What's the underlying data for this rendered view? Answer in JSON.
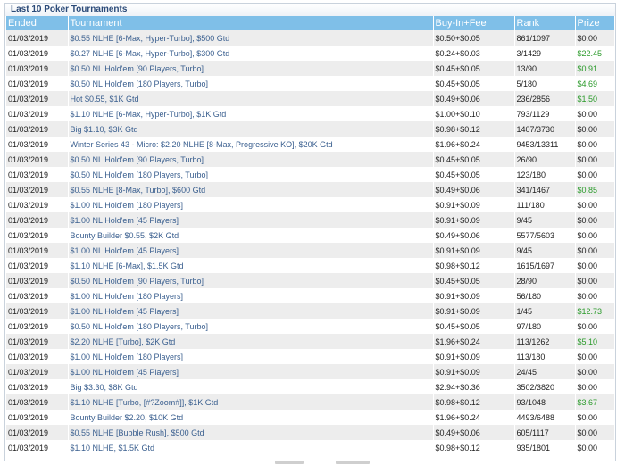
{
  "panel": {
    "title": "Last 10 Poker Tournaments"
  },
  "columns": [
    "Ended",
    "Tournament",
    "Buy-In+Fee",
    "Rank",
    "Prize"
  ],
  "rows": [
    {
      "ended": "01/03/2019",
      "tournament": "$0.55 NLHE [6-Max, Hyper-Turbo], $500 Gtd",
      "buyin": "$0.50+$0.05",
      "rank": "861/1097",
      "prize": "$0.00",
      "win": false
    },
    {
      "ended": "01/03/2019",
      "tournament": "$0.27 NLHE [6-Max, Hyper-Turbo], $300 Gtd",
      "buyin": "$0.24+$0.03",
      "rank": "3/1429",
      "prize": "$22.45",
      "win": true
    },
    {
      "ended": "01/03/2019",
      "tournament": "$0.50 NL Hold'em [90 Players, Turbo]",
      "buyin": "$0.45+$0.05",
      "rank": "13/90",
      "prize": "$0.91",
      "win": true
    },
    {
      "ended": "01/03/2019",
      "tournament": "$0.50 NL Hold'em [180 Players, Turbo]",
      "buyin": "$0.45+$0.05",
      "rank": "5/180",
      "prize": "$4.69",
      "win": true
    },
    {
      "ended": "01/03/2019",
      "tournament": "Hot $0.55, $1K Gtd",
      "buyin": "$0.49+$0.06",
      "rank": "236/2856",
      "prize": "$1.50",
      "win": true
    },
    {
      "ended": "01/03/2019",
      "tournament": "$1.10 NLHE [6-Max, Hyper-Turbo], $1K Gtd",
      "buyin": "$1.00+$0.10",
      "rank": "793/1129",
      "prize": "$0.00",
      "win": false
    },
    {
      "ended": "01/03/2019",
      "tournament": "Big $1.10, $3K Gtd",
      "buyin": "$0.98+$0.12",
      "rank": "1407/3730",
      "prize": "$0.00",
      "win": false
    },
    {
      "ended": "01/03/2019",
      "tournament": "Winter Series 43 - Micro: $2.20 NLHE [8-Max, Progressive KO], $20K Gtd",
      "buyin": "$1.96+$0.24",
      "rank": "9453/13311",
      "prize": "$0.00",
      "win": false
    },
    {
      "ended": "01/03/2019",
      "tournament": "$0.50 NL Hold'em [90 Players, Turbo]",
      "buyin": "$0.45+$0.05",
      "rank": "26/90",
      "prize": "$0.00",
      "win": false
    },
    {
      "ended": "01/03/2019",
      "tournament": "$0.50 NL Hold'em [180 Players, Turbo]",
      "buyin": "$0.45+$0.05",
      "rank": "123/180",
      "prize": "$0.00",
      "win": false
    },
    {
      "ended": "01/03/2019",
      "tournament": "$0.55 NLHE [8-Max, Turbo], $600 Gtd",
      "buyin": "$0.49+$0.06",
      "rank": "341/1467",
      "prize": "$0.85",
      "win": true
    },
    {
      "ended": "01/03/2019",
      "tournament": "$1.00 NL Hold'em [180 Players]",
      "buyin": "$0.91+$0.09",
      "rank": "111/180",
      "prize": "$0.00",
      "win": false
    },
    {
      "ended": "01/03/2019",
      "tournament": "$1.00 NL Hold'em [45 Players]",
      "buyin": "$0.91+$0.09",
      "rank": "9/45",
      "prize": "$0.00",
      "win": false
    },
    {
      "ended": "01/03/2019",
      "tournament": "Bounty Builder $0.55, $2K Gtd",
      "buyin": "$0.49+$0.06",
      "rank": "5577/5603",
      "prize": "$0.00",
      "win": false
    },
    {
      "ended": "01/03/2019",
      "tournament": "$1.00 NL Hold'em [45 Players]",
      "buyin": "$0.91+$0.09",
      "rank": "9/45",
      "prize": "$0.00",
      "win": false
    },
    {
      "ended": "01/03/2019",
      "tournament": "$1.10 NLHE [6-Max], $1.5K Gtd",
      "buyin": "$0.98+$0.12",
      "rank": "1615/1697",
      "prize": "$0.00",
      "win": false
    },
    {
      "ended": "01/03/2019",
      "tournament": "$0.50 NL Hold'em [90 Players, Turbo]",
      "buyin": "$0.45+$0.05",
      "rank": "28/90",
      "prize": "$0.00",
      "win": false
    },
    {
      "ended": "01/03/2019",
      "tournament": "$1.00 NL Hold'em [180 Players]",
      "buyin": "$0.91+$0.09",
      "rank": "56/180",
      "prize": "$0.00",
      "win": false
    },
    {
      "ended": "01/03/2019",
      "tournament": "$1.00 NL Hold'em [45 Players]",
      "buyin": "$0.91+$0.09",
      "rank": "1/45",
      "prize": "$12.73",
      "win": true
    },
    {
      "ended": "01/03/2019",
      "tournament": "$0.50 NL Hold'em [180 Players, Turbo]",
      "buyin": "$0.45+$0.05",
      "rank": "97/180",
      "prize": "$0.00",
      "win": false
    },
    {
      "ended": "01/03/2019",
      "tournament": "$2.20 NLHE [Turbo], $2K Gtd",
      "buyin": "$1.96+$0.24",
      "rank": "113/1262",
      "prize": "$5.10",
      "win": true
    },
    {
      "ended": "01/03/2019",
      "tournament": "$1.00 NL Hold'em [180 Players]",
      "buyin": "$0.91+$0.09",
      "rank": "113/180",
      "prize": "$0.00",
      "win": false
    },
    {
      "ended": "01/03/2019",
      "tournament": "$1.00 NL Hold'em [45 Players]",
      "buyin": "$0.91+$0.09",
      "rank": "24/45",
      "prize": "$0.00",
      "win": false
    },
    {
      "ended": "01/03/2019",
      "tournament": "Big $3.30, $8K Gtd",
      "buyin": "$2.94+$0.36",
      "rank": "3502/3820",
      "prize": "$0.00",
      "win": false
    },
    {
      "ended": "01/03/2019",
      "tournament": "$1.10 NLHE [Turbo, [#?Zoom#]], $1K Gtd",
      "buyin": "$0.98+$0.12",
      "rank": "93/1048",
      "prize": "$3.67",
      "win": true
    },
    {
      "ended": "01/03/2019",
      "tournament": "Bounty Builder $2.20, $10K Gtd",
      "buyin": "$1.96+$0.24",
      "rank": "4493/6488",
      "prize": "$0.00",
      "win": false
    },
    {
      "ended": "01/03/2019",
      "tournament": "$0.55 NLHE [Bubble Rush], $500 Gtd",
      "buyin": "$0.49+$0.06",
      "rank": "605/1117",
      "prize": "$0.00",
      "win": false
    },
    {
      "ended": "01/03/2019",
      "tournament": "$1.10 NLHE, $1.5K Gtd",
      "buyin": "$0.98+$0.12",
      "rank": "935/1801",
      "prize": "$0.00",
      "win": false
    }
  ],
  "colors": {
    "header_bg": "#7fbfe8",
    "title_text": "#2b4a78",
    "tournament_text": "#3a5f8f",
    "prize_win": "#2a9a2a",
    "row_alt": "#ededed"
  }
}
